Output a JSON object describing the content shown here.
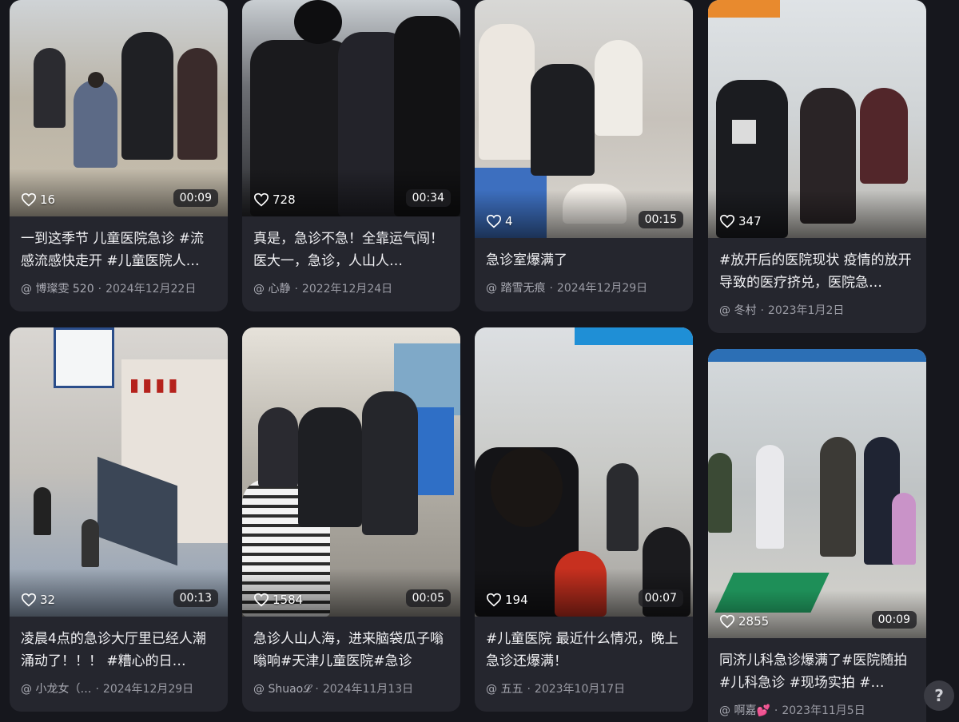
{
  "cards": [
    {
      "likes": "16",
      "duration": "00:09",
      "title": "一到这季节 儿童医院急诊 #流感流感快走开 #儿童医院人…",
      "author": "@ 博璨雯 520",
      "date": "2024年12月22日"
    },
    {
      "likes": "728",
      "duration": "00:34",
      "title": "真是，急诊不急！全靠运气闯！医大一，急诊，人山人…",
      "author": "@ 心静",
      "date": "2022年12月24日"
    },
    {
      "likes": "4",
      "duration": "00:15",
      "title": "急诊室爆满了",
      "author": "@ 踏雪无痕",
      "date": "2024年12月29日"
    },
    {
      "likes": "347",
      "duration": "",
      "title": "#放开后的医院现状 疫情的放开导致的医疗挤兑，医院急…",
      "author": "@ 冬村",
      "date": "2023年1月2日"
    },
    {
      "likes": "32",
      "duration": "00:13",
      "title": "凌晨4点的急诊大厅里已经人潮涌动了！！！ #糟心的日…",
      "author": "@ 小龙女（…",
      "date": "2024年12月29日"
    },
    {
      "likes": "1584",
      "duration": "00:05",
      "title": "急诊人山人海，进来脑袋瓜子嗡嗡响#天津儿童医院#急诊",
      "author": "@ Shuao𝓛",
      "date": "2024年11月13日"
    },
    {
      "likes": "194",
      "duration": "00:07",
      "title": "#儿童医院 最近什么情况，晚上急诊还爆满！",
      "author": "@ 五五",
      "date": "2023年10月17日"
    },
    {
      "likes": "2855",
      "duration": "00:09",
      "title": "同济儿科急诊爆满了#医院随拍 #儿科急诊 #现场实拍 #…",
      "author": "@ 啊嘉💕",
      "date": "2023年11月5日"
    }
  ],
  "help_label": "?",
  "icons": {
    "like": "heart-outline-icon",
    "help": "question-mark-icon"
  }
}
